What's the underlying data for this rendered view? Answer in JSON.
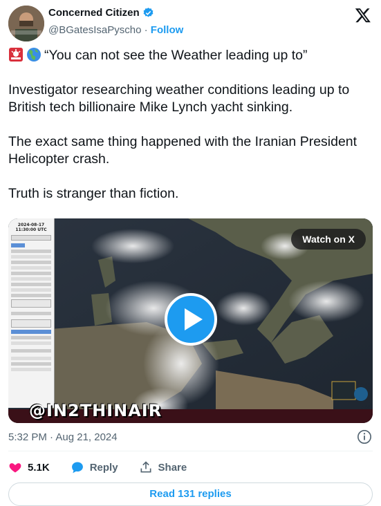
{
  "author": {
    "name": "Concerned Citizen",
    "handle": "@BGatesIsaPyscho",
    "separator": "·",
    "follow_label": "Follow",
    "verified_color": "#1d9bf0"
  },
  "tweet": {
    "lines": [
      "“You can not see the Weather leading up to”",
      "Investigator researching weather conditions leading up to British tech billionaire Mike Lynch yacht sinking.",
      "The exact same thing happened with the Iranian President Helicopter crash.",
      "Truth is stranger than fiction."
    ],
    "emojis": [
      "rotating-light-icon",
      "globe-europe-africa-icon"
    ]
  },
  "media": {
    "watch_label": "Watch on X",
    "watermark": "@IN2THINAIR",
    "panel_date": "2024-08-17",
    "panel_time": "11:30:00 UTC"
  },
  "meta": {
    "timestamp": "5:32 PM · Aug 21, 2024"
  },
  "actions": {
    "likes": "5.1K",
    "reply_label": "Reply",
    "share_label": "Share"
  },
  "footer": {
    "read_replies": "Read 131 replies"
  },
  "colors": {
    "accent": "#1d9bf0",
    "like": "#f91880",
    "muted": "#536471"
  }
}
